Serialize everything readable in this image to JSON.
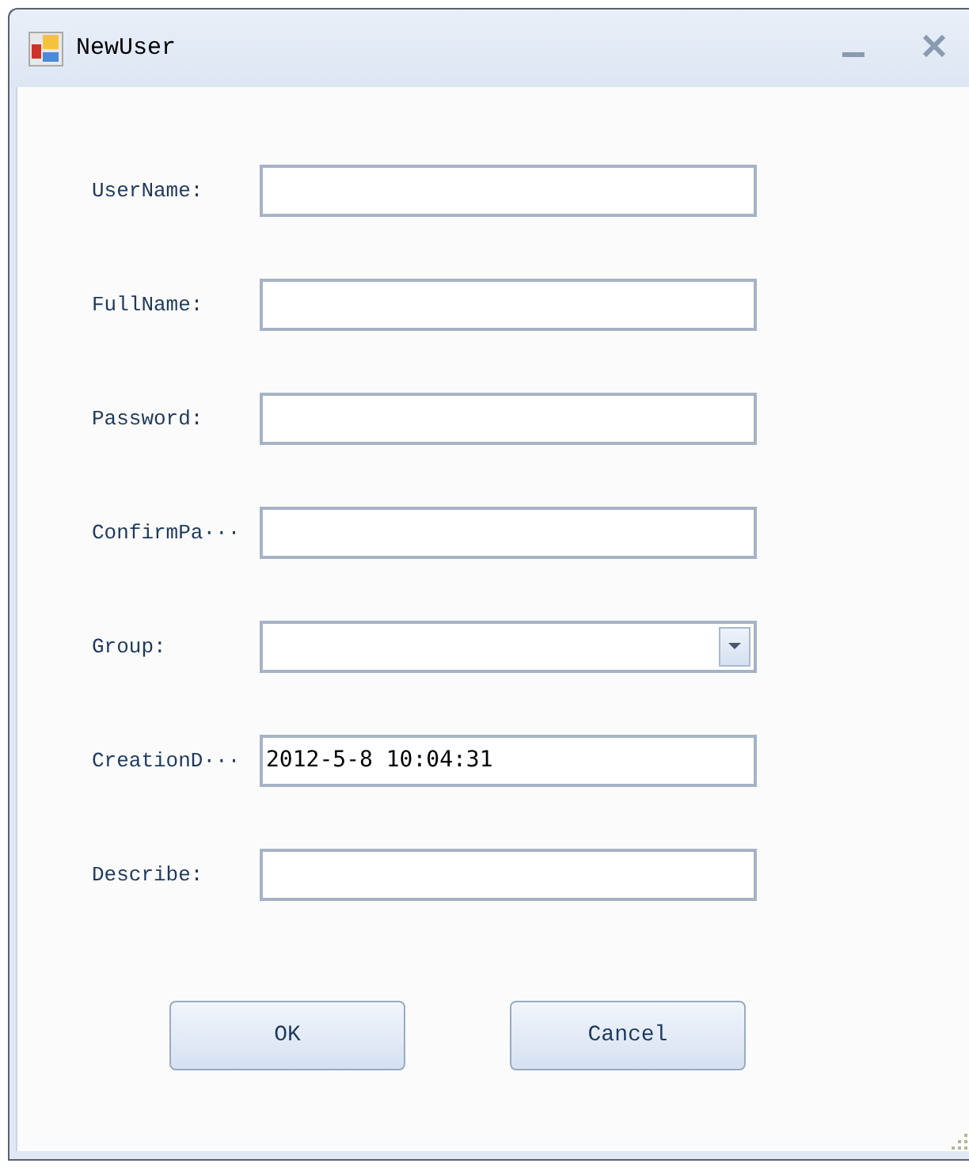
{
  "window": {
    "title": "NewUser"
  },
  "fields": [
    {
      "label": "UserName:",
      "kind": "text"
    },
    {
      "label": "FullName:",
      "kind": "text"
    },
    {
      "label": "Password:",
      "kind": "text"
    },
    {
      "label": "ConfirmPa···",
      "kind": "text"
    },
    {
      "label": "Group:",
      "kind": "dropdown"
    },
    {
      "label": "CreationD···",
      "kind": "text",
      "value": "2012-5-8 10:04:31"
    },
    {
      "label": "Describe:",
      "kind": "text"
    }
  ],
  "buttons": [
    "OK",
    "Cancel"
  ]
}
